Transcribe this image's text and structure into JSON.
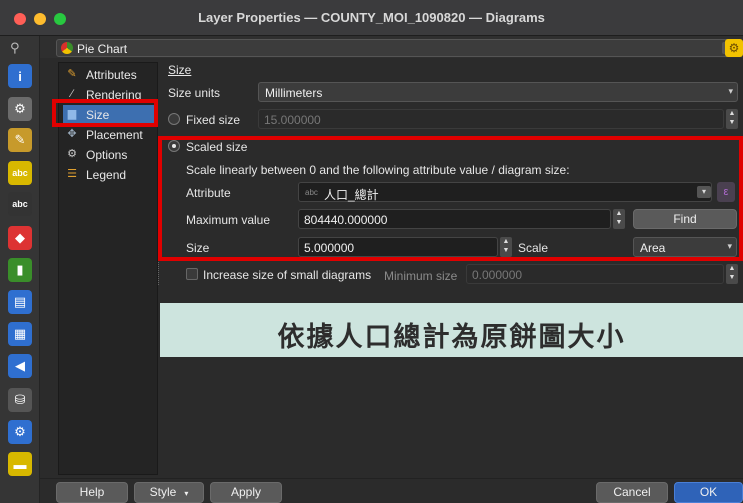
{
  "window": {
    "title": "Layer Properties — COUNTY_MOI_1090820 — Diagrams"
  },
  "rail": {
    "search_icon": "search-icon",
    "icons": [
      {
        "name": "information-icon",
        "glyph": "i",
        "color": "#2f6fd0"
      },
      {
        "name": "source-icon",
        "glyph": "⚙",
        "color": "#6b6b6b"
      },
      {
        "name": "symbology-icon",
        "glyph": "✎",
        "color": "#c79a2b"
      },
      {
        "name": "labels-icon",
        "glyph": "abc",
        "color": "#d8b800"
      },
      {
        "name": "masks-icon",
        "glyph": "abc",
        "color": "#333"
      },
      {
        "name": "3d-view-icon",
        "glyph": "◆",
        "color": "#d33"
      },
      {
        "name": "diagrams-icon",
        "glyph": "▮",
        "color": "#3a8e2a"
      },
      {
        "name": "fields-icon",
        "glyph": "▤",
        "color": "#2f6fd0"
      },
      {
        "name": "attributes-form-icon",
        "glyph": "▦",
        "color": "#2f6fd0"
      },
      {
        "name": "joins-icon",
        "glyph": "◀",
        "color": "#2f6fd0"
      },
      {
        "name": "auxiliary-storage-icon",
        "glyph": "⛁",
        "color": "#555"
      },
      {
        "name": "actions-icon",
        "glyph": "⚙",
        "color": "#2f6fd0"
      },
      {
        "name": "display-icon",
        "glyph": "▬",
        "color": "#d8b800"
      }
    ]
  },
  "renderer": {
    "selected": "Pie Chart"
  },
  "nav": {
    "items": [
      {
        "label": "Attributes",
        "icon": "attributes-icon"
      },
      {
        "label": "Rendering",
        "icon": "rendering-icon"
      },
      {
        "label": "Size",
        "icon": "size-icon"
      },
      {
        "label": "Placement",
        "icon": "placement-icon"
      },
      {
        "label": "Options",
        "icon": "options-icon"
      },
      {
        "label": "Legend",
        "icon": "legend-icon"
      }
    ],
    "active_index": 2
  },
  "size": {
    "section_title": "Size",
    "units_label": "Size units",
    "units_value": "Millimeters",
    "fixed_label": "Fixed size",
    "fixed_value": "15.000000",
    "scaled_label": "Scaled size",
    "scaled_desc": "Scale linearly between 0 and the following attribute value / diagram size:",
    "attribute_label": "Attribute",
    "attribute_type": "abc",
    "attribute_value": "人口_總計",
    "max_label": "Maximum value",
    "max_value": "804440.000000",
    "find_label": "Find",
    "size_label": "Size",
    "size_value": "5.000000",
    "scale_label": "Scale",
    "scale_value": "Area",
    "increase_label": "Increase size of small diagrams",
    "min_size_label": "Minimum size",
    "min_size_value": "0.000000"
  },
  "banner": {
    "text": "依據人口總計為原餅圖大小"
  },
  "buttons": {
    "help": "Help",
    "style": "Style",
    "apply": "Apply",
    "cancel": "Cancel",
    "ok": "OK"
  },
  "colors": {
    "highlight": "#e00000",
    "banner_bg": "#cde4de",
    "ok_button": "#2f63b8"
  }
}
